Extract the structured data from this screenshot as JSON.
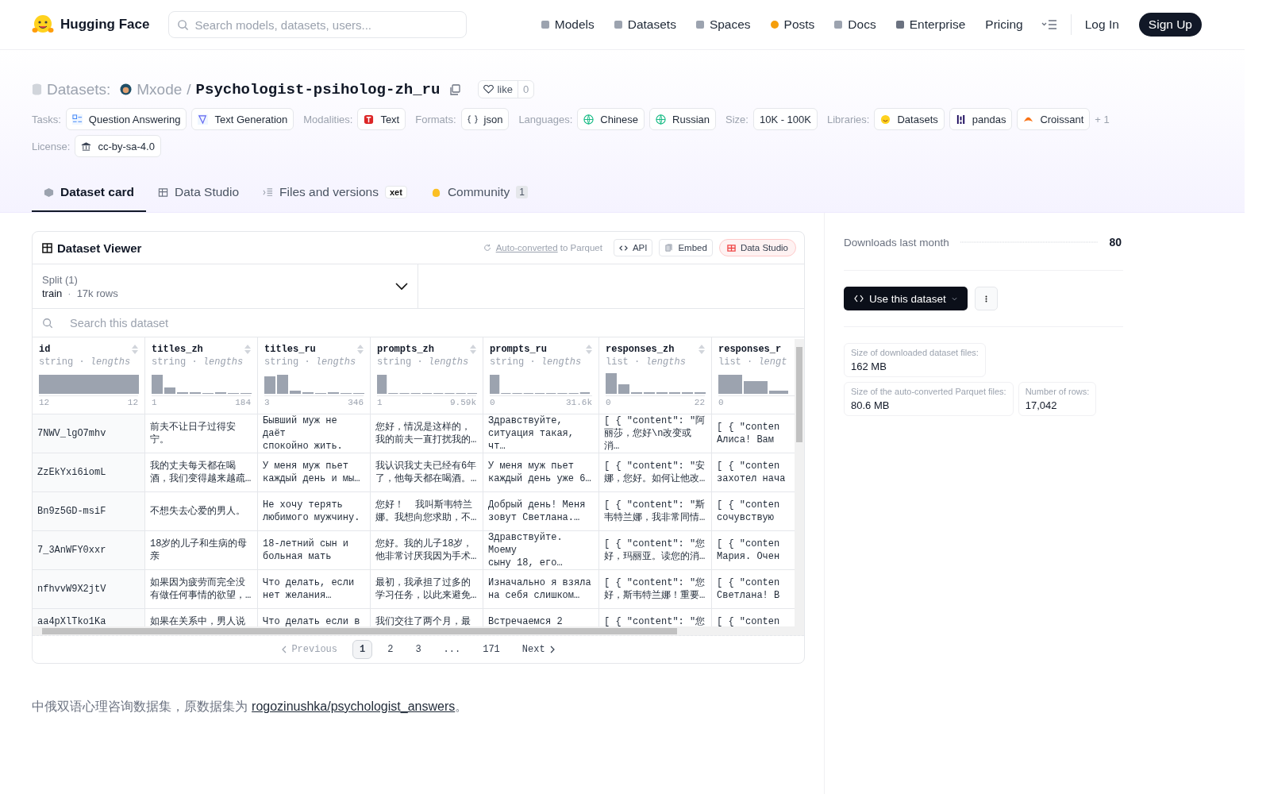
{
  "header": {
    "brand": "Hugging Face",
    "search": {
      "placeholder": "Search models, datasets, users..."
    },
    "nav": [
      {
        "label": "Models"
      },
      {
        "label": "Datasets"
      },
      {
        "label": "Spaces"
      },
      {
        "label": "Posts"
      },
      {
        "label": "Docs"
      },
      {
        "label": "Enterprise"
      },
      {
        "label": "Pricing"
      }
    ],
    "login": "Log In",
    "signup": "Sign Up"
  },
  "title": {
    "section": "Datasets:",
    "owner": "Mxode",
    "separator": "/",
    "name": "Psychologist-psiholog-zh_ru",
    "like": {
      "label": "like",
      "count": "0"
    }
  },
  "tags": [
    {
      "label": "Tasks:",
      "items": [
        "Question Answering",
        "Text Generation"
      ]
    },
    {
      "label": "Modalities:",
      "items": [
        "Text"
      ]
    },
    {
      "label": "Formats:",
      "items": [
        "json"
      ]
    },
    {
      "label": "Languages:",
      "items": [
        "Chinese",
        "Russian"
      ]
    },
    {
      "label": "Size:",
      "items": [
        "10K - 100K"
      ]
    },
    {
      "label": "Libraries:",
      "items": [
        "Datasets",
        "pandas",
        "Croissant"
      ],
      "more": "+ 1"
    },
    {
      "label": "License:",
      "items": [
        "cc-by-sa-4.0"
      ]
    }
  ],
  "tabs": [
    {
      "label": "Dataset card",
      "selected": true
    },
    {
      "label": "Data Studio",
      "selected": false
    },
    {
      "label": "Files and versions",
      "badge": "xet",
      "selected": false
    },
    {
      "label": "Community",
      "count": "1",
      "selected": false
    }
  ],
  "viewer": {
    "title": "Dataset Viewer",
    "converted_link": "Auto-converted",
    "converted_text": "to Parquet",
    "buttons": [
      "API",
      "Embed",
      "Data Studio"
    ],
    "split": {
      "label": "Split (1)",
      "name": "train",
      "separator": "·",
      "rows": "17k rows"
    },
    "search": {
      "placeholder": "Search this dataset"
    },
    "columns": [
      {
        "name": "id",
        "type": "string",
        "separator": "·",
        "stat": "lengths",
        "min": "12",
        "max": "12"
      },
      {
        "name": "titles_zh",
        "type": "string",
        "separator": "·",
        "stat": "lengths",
        "min": "1",
        "max": "184"
      },
      {
        "name": "titles_ru",
        "type": "string",
        "separator": "·",
        "stat": "lengths",
        "min": "3",
        "max": "346"
      },
      {
        "name": "prompts_zh",
        "type": "string",
        "separator": "·",
        "stat": "lengths",
        "min": "1",
        "max": "9.59k"
      },
      {
        "name": "prompts_ru",
        "type": "string",
        "separator": "·",
        "stat": "lengths",
        "min": "0",
        "max": "31.6k"
      },
      {
        "name": "responses_zh",
        "type": "list",
        "separator": "·",
        "stat": "lengths",
        "min": "0",
        "max": "22"
      },
      {
        "name": "responses_r",
        "type": "list",
        "separator": "·",
        "stat": "lengt",
        "min": "0"
      }
    ],
    "rows": [
      [
        "7NWV_lgO7mhv",
        "前夫不让日子过得安宁。",
        "Бывший муж не даёт\nспокойно жить.",
        "您好，情况是这样的，我的前夫一直打扰我的…",
        "Здравствуйте,\nситуация такая, чт…",
        "[ { \"content\": \"阿丽莎，您好\\n改变或消…",
        "[ { \"conten\nАлиса! Вам"
      ],
      [
        "ZzEkYxi6iomL",
        "我的丈夫每天都在喝酒，我们变得越来越疏…",
        "У меня муж пьет\nкаждый день и мы…",
        "我认识我丈夫已经有6年了，他每天都在喝酒。…",
        "У меня муж пьет\nкаждый день уже 6…",
        "[ { \"content\": \"安娜，您好。如何让他改…",
        "[ { \"conten\nзахотел нача"
      ],
      [
        "Bn9z5GD-msiF",
        "不想失去心爱的男人。",
        "Не хочу терять\nлюбимого мужчину.",
        "您好！  我叫斯韦特兰娜。我想向您求助，不…",
        "Добрый день! Меня\nзовут Светлана.…",
        "[ { \"content\": \"斯韦特兰娜，我非常同情…",
        "[ { \"conten\nсочувствую"
      ],
      [
        "7_3AnWFY0xxr",
        "18岁的儿子和生病的母亲",
        "18-летний сын и\nбольная мать",
        "您好。我的儿子18岁，他非常讨厌我因为手术…",
        "Здравствуйте. Моему\nсыну 18, его…",
        "[ { \"content\": \"您好，玛丽亚。读您的消…",
        "[ { \"conten\nМария. Очен"
      ],
      [
        "nfhvvW9X2jtV",
        "如果因为疲劳而完全没有做任何事情的欲望，…",
        "Что делать, если\nнет желания…",
        "最初，我承担了过多的学习任务，以此来避免…",
        "Изначально я взяла\nна себя слишком…",
        "[ { \"content\": \"您好，斯韦特兰娜！重要…",
        "[ { \"conten\nСветлана! В"
      ],
      [
        "aa4pXlTko1Ka",
        "如果在关系中，男人说",
        "Что делать если в",
        "我们交往了两个月，最",
        "Встречаемся 2",
        "[ { \"content\": \"您",
        "[ { \"conten"
      ]
    ],
    "pagination": [
      {
        "label": "Previous",
        "kind": "prev",
        "disabled": true
      },
      {
        "label": "1",
        "kind": "page",
        "selected": true
      },
      {
        "label": "2",
        "kind": "page",
        "selected": false
      },
      {
        "label": "3",
        "kind": "page",
        "selected": false
      },
      {
        "label": "...",
        "kind": "gap"
      },
      {
        "label": "171",
        "kind": "page",
        "selected": false
      },
      {
        "label": "Next",
        "kind": "next",
        "disabled": false
      }
    ]
  },
  "description": {
    "text": "中俄双语心理咨询数据集，原数据集为 ",
    "link": "rogozinushka/psychologist_answers",
    "end": "。"
  },
  "sidebar": {
    "downloads_label": "Downloads last month",
    "downloads": "80",
    "use_button": "Use this dataset",
    "stats": [
      {
        "label": "Size of downloaded dataset files:",
        "value": "162 MB"
      },
      {
        "label": "Size of the auto-converted Parquet files:",
        "value": "80.6 MB"
      },
      {
        "label": "Number of rows:",
        "value": "17,042"
      }
    ]
  }
}
